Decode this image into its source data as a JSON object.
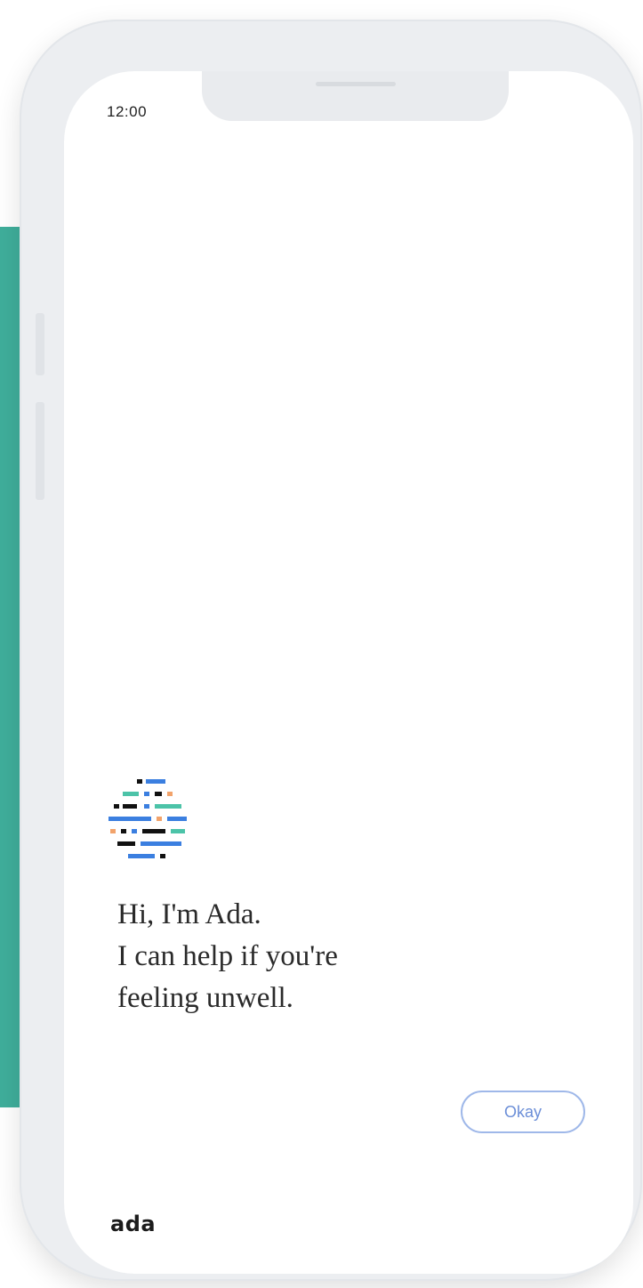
{
  "status_bar": {
    "time": "12:00"
  },
  "chat": {
    "avatar_icon": "ada-pixel-avatar-icon",
    "greeting_lines": [
      "Hi, I'm Ada.",
      "I can help if you're",
      "feeling unwell."
    ],
    "okay_label": "Okay"
  },
  "brand": {
    "logo_text": "ada"
  },
  "colors": {
    "accent_teal": "#3fae9b",
    "button_border": "#9fb8e9",
    "button_text": "#6c8fd8"
  }
}
